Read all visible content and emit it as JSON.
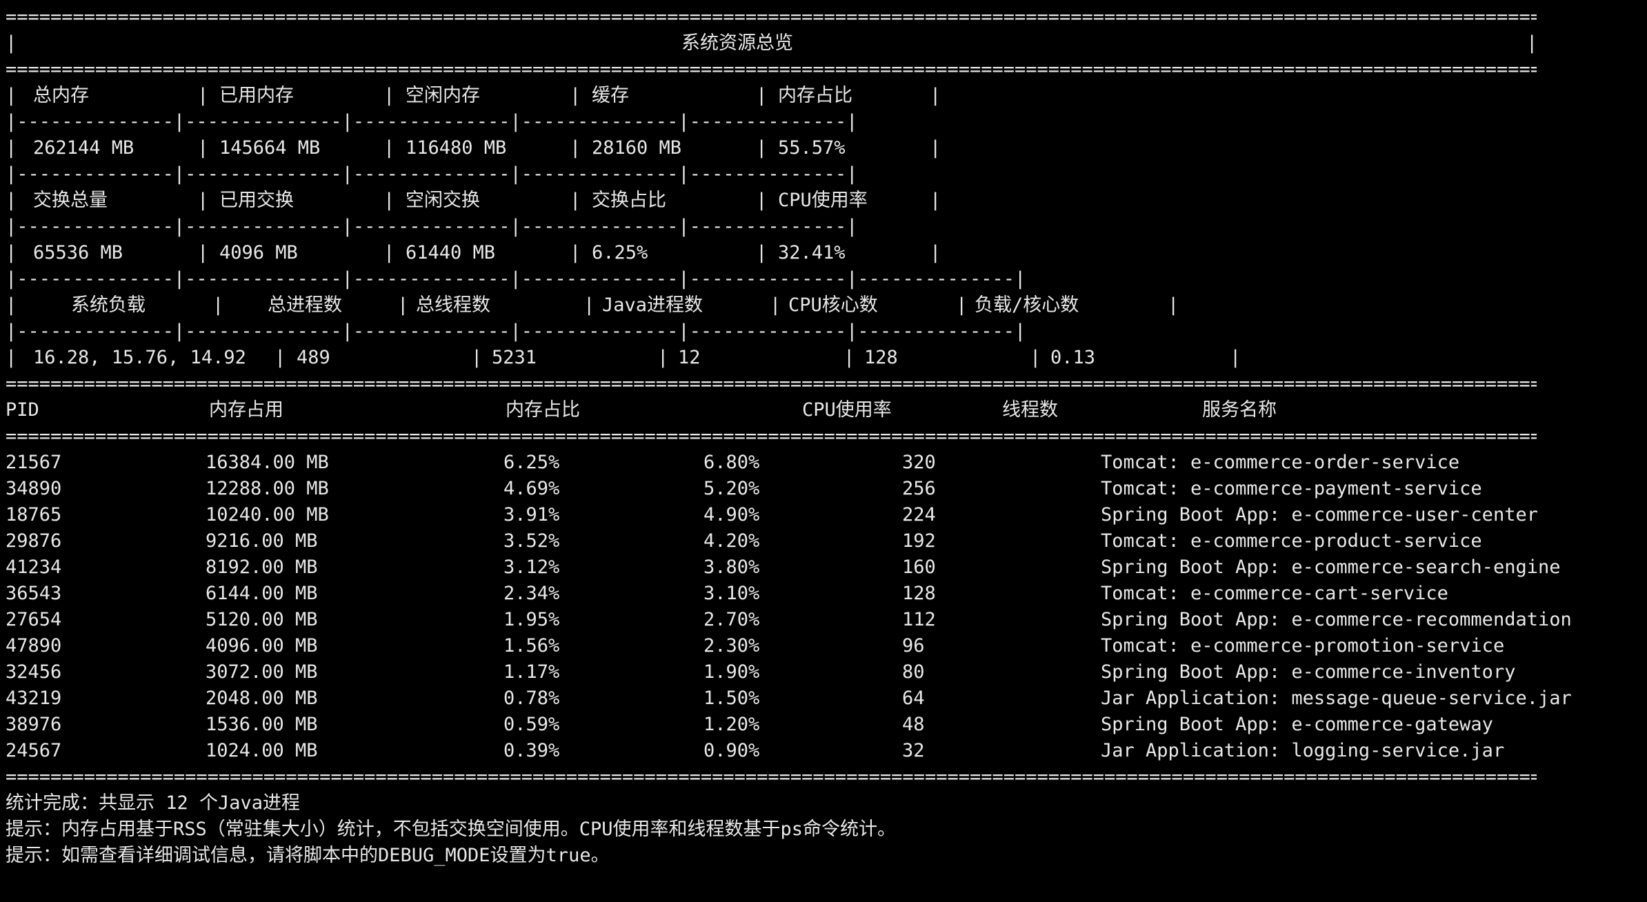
{
  "summary_title": "系统资源总览",
  "memory_labels": [
    "总内存",
    "已用内存",
    "空闲内存",
    "缓存",
    "内存占比"
  ],
  "memory_values": [
    "262144 MB",
    "145664 MB",
    "116480 MB",
    "28160 MB",
    "55.57%"
  ],
  "swap_labels": [
    "交换总量",
    "已用交换",
    "空闲交换",
    "交换占比",
    "CPU使用率"
  ],
  "swap_values": [
    "65536 MB",
    "4096 MB",
    "61440 MB",
    "6.25%",
    "32.41%"
  ],
  "load_labels": [
    "系统负载",
    "总进程数",
    "总线程数",
    "Java进程数",
    "CPU核心数",
    "负载/核心数"
  ],
  "load_values": [
    "16.28, 15.76, 14.92",
    "489",
    "5231",
    "12",
    "128",
    "0.13"
  ],
  "process_table": {
    "headers": [
      "PID",
      "内存占用",
      "内存占比",
      "CPU使用率",
      "线程数",
      "服务名称"
    ],
    "rows": [
      [
        "21567",
        "16384.00 MB",
        "6.25%",
        "6.80%",
        "320",
        "Tomcat: e-commerce-order-service"
      ],
      [
        "34890",
        "12288.00 MB",
        "4.69%",
        "5.20%",
        "256",
        "Tomcat: e-commerce-payment-service"
      ],
      [
        "18765",
        "10240.00 MB",
        "3.91%",
        "4.90%",
        "224",
        "Spring Boot App: e-commerce-user-center"
      ],
      [
        "29876",
        "9216.00 MB",
        "3.52%",
        "4.20%",
        "192",
        "Tomcat: e-commerce-product-service"
      ],
      [
        "41234",
        "8192.00 MB",
        "3.12%",
        "3.80%",
        "160",
        "Spring Boot App: e-commerce-search-engine"
      ],
      [
        "36543",
        "6144.00 MB",
        "2.34%",
        "3.10%",
        "128",
        "Tomcat: e-commerce-cart-service"
      ],
      [
        "27654",
        "5120.00 MB",
        "1.95%",
        "2.70%",
        "112",
        "Spring Boot App: e-commerce-recommendation"
      ],
      [
        "47890",
        "4096.00 MB",
        "1.56%",
        "2.30%",
        "96",
        "Tomcat: e-commerce-promotion-service"
      ],
      [
        "32456",
        "3072.00 MB",
        "1.17%",
        "1.90%",
        "80",
        "Spring Boot App: e-commerce-inventory"
      ],
      [
        "43219",
        "2048.00 MB",
        "0.78%",
        "1.50%",
        "64",
        "Jar Application: message-queue-service.jar"
      ],
      [
        "38976",
        "1536.00 MB",
        "0.59%",
        "1.20%",
        "48",
        "Spring Boot App: e-commerce-gateway"
      ],
      [
        "24567",
        "1024.00 MB",
        "0.39%",
        "0.90%",
        "32",
        "Jar Application: logging-service.jar"
      ]
    ]
  },
  "footer_lines": [
    "统计完成：共显示 12 个Java进程",
    "提示：内存占用基于RSS（常驻集大小）统计，不包括交换空间使用。CPU使用率和线程数基于ps命令统计。",
    "提示：如需查看详细调试信息，请将脚本中的DEBUG_MODE设置为true。"
  ]
}
